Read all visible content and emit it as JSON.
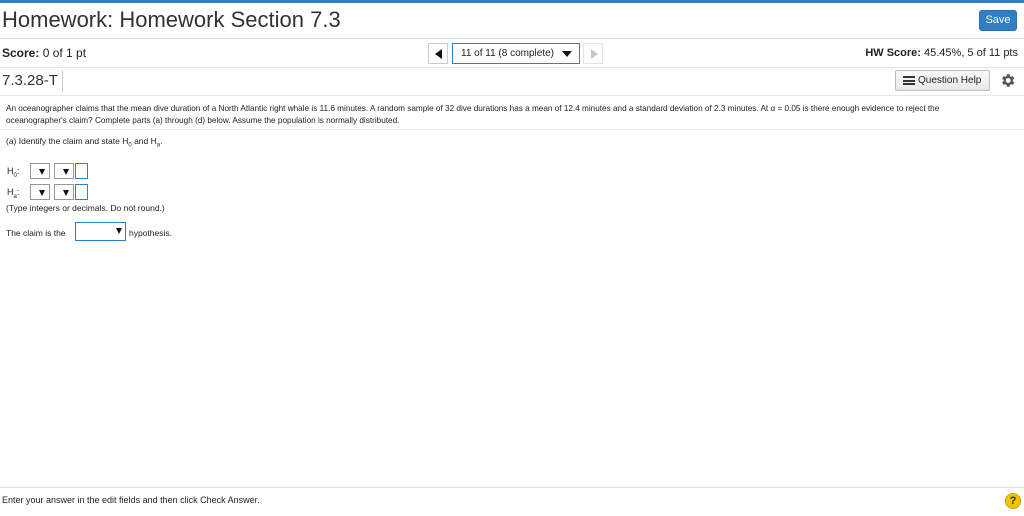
{
  "header": {
    "title": "Homework: Homework Section 7.3",
    "save_label": "Save"
  },
  "score_bar": {
    "score_label": "Score:",
    "score_value": "0 of 1 pt",
    "nav_current": "11 of 11 (8 complete)",
    "hw_score_label": "HW Score:",
    "hw_score_value": "45.45%, 5 of 11 pts"
  },
  "question": {
    "id": "7.3.28-T",
    "help_label": "Question Help",
    "text": "An oceanographer claims that the mean dive duration of a North Atlantic right whale is 11.6 minutes. A random sample of 32 dive durations has a mean of 12.4 minutes and a standard deviation of 2.3 minutes. At α = 0.05 is there enough evidence to reject the oceanographer's claim? Complete parts (a) through (d) below. Assume the population is normally distributed.",
    "part_a": "(a) Identify the claim and state H",
    "part_a_sub0": "0",
    "part_a_and": " and H",
    "part_a_suba": "a",
    "part_a_end": ".",
    "h0_label": "H",
    "h0_sub": "0",
    "ha_label": "H",
    "ha_sub": "a",
    "colon": ":",
    "hint": "(Type integers or decimals. Do not round.)",
    "claim_prefix": "The claim is the",
    "claim_suffix": "hypothesis."
  },
  "footer": {
    "instruction": "Enter your answer in the edit fields and then click Check Answer.",
    "help_symbol": "?"
  },
  "colors": {
    "accent": "#2f7fc6",
    "help_yellow": "#f0c400"
  },
  "icons": {
    "prev": "triangle-left-icon",
    "next": "triangle-right-icon",
    "menu": "list-icon",
    "settings": "gear-icon",
    "help": "question-circle-icon"
  }
}
